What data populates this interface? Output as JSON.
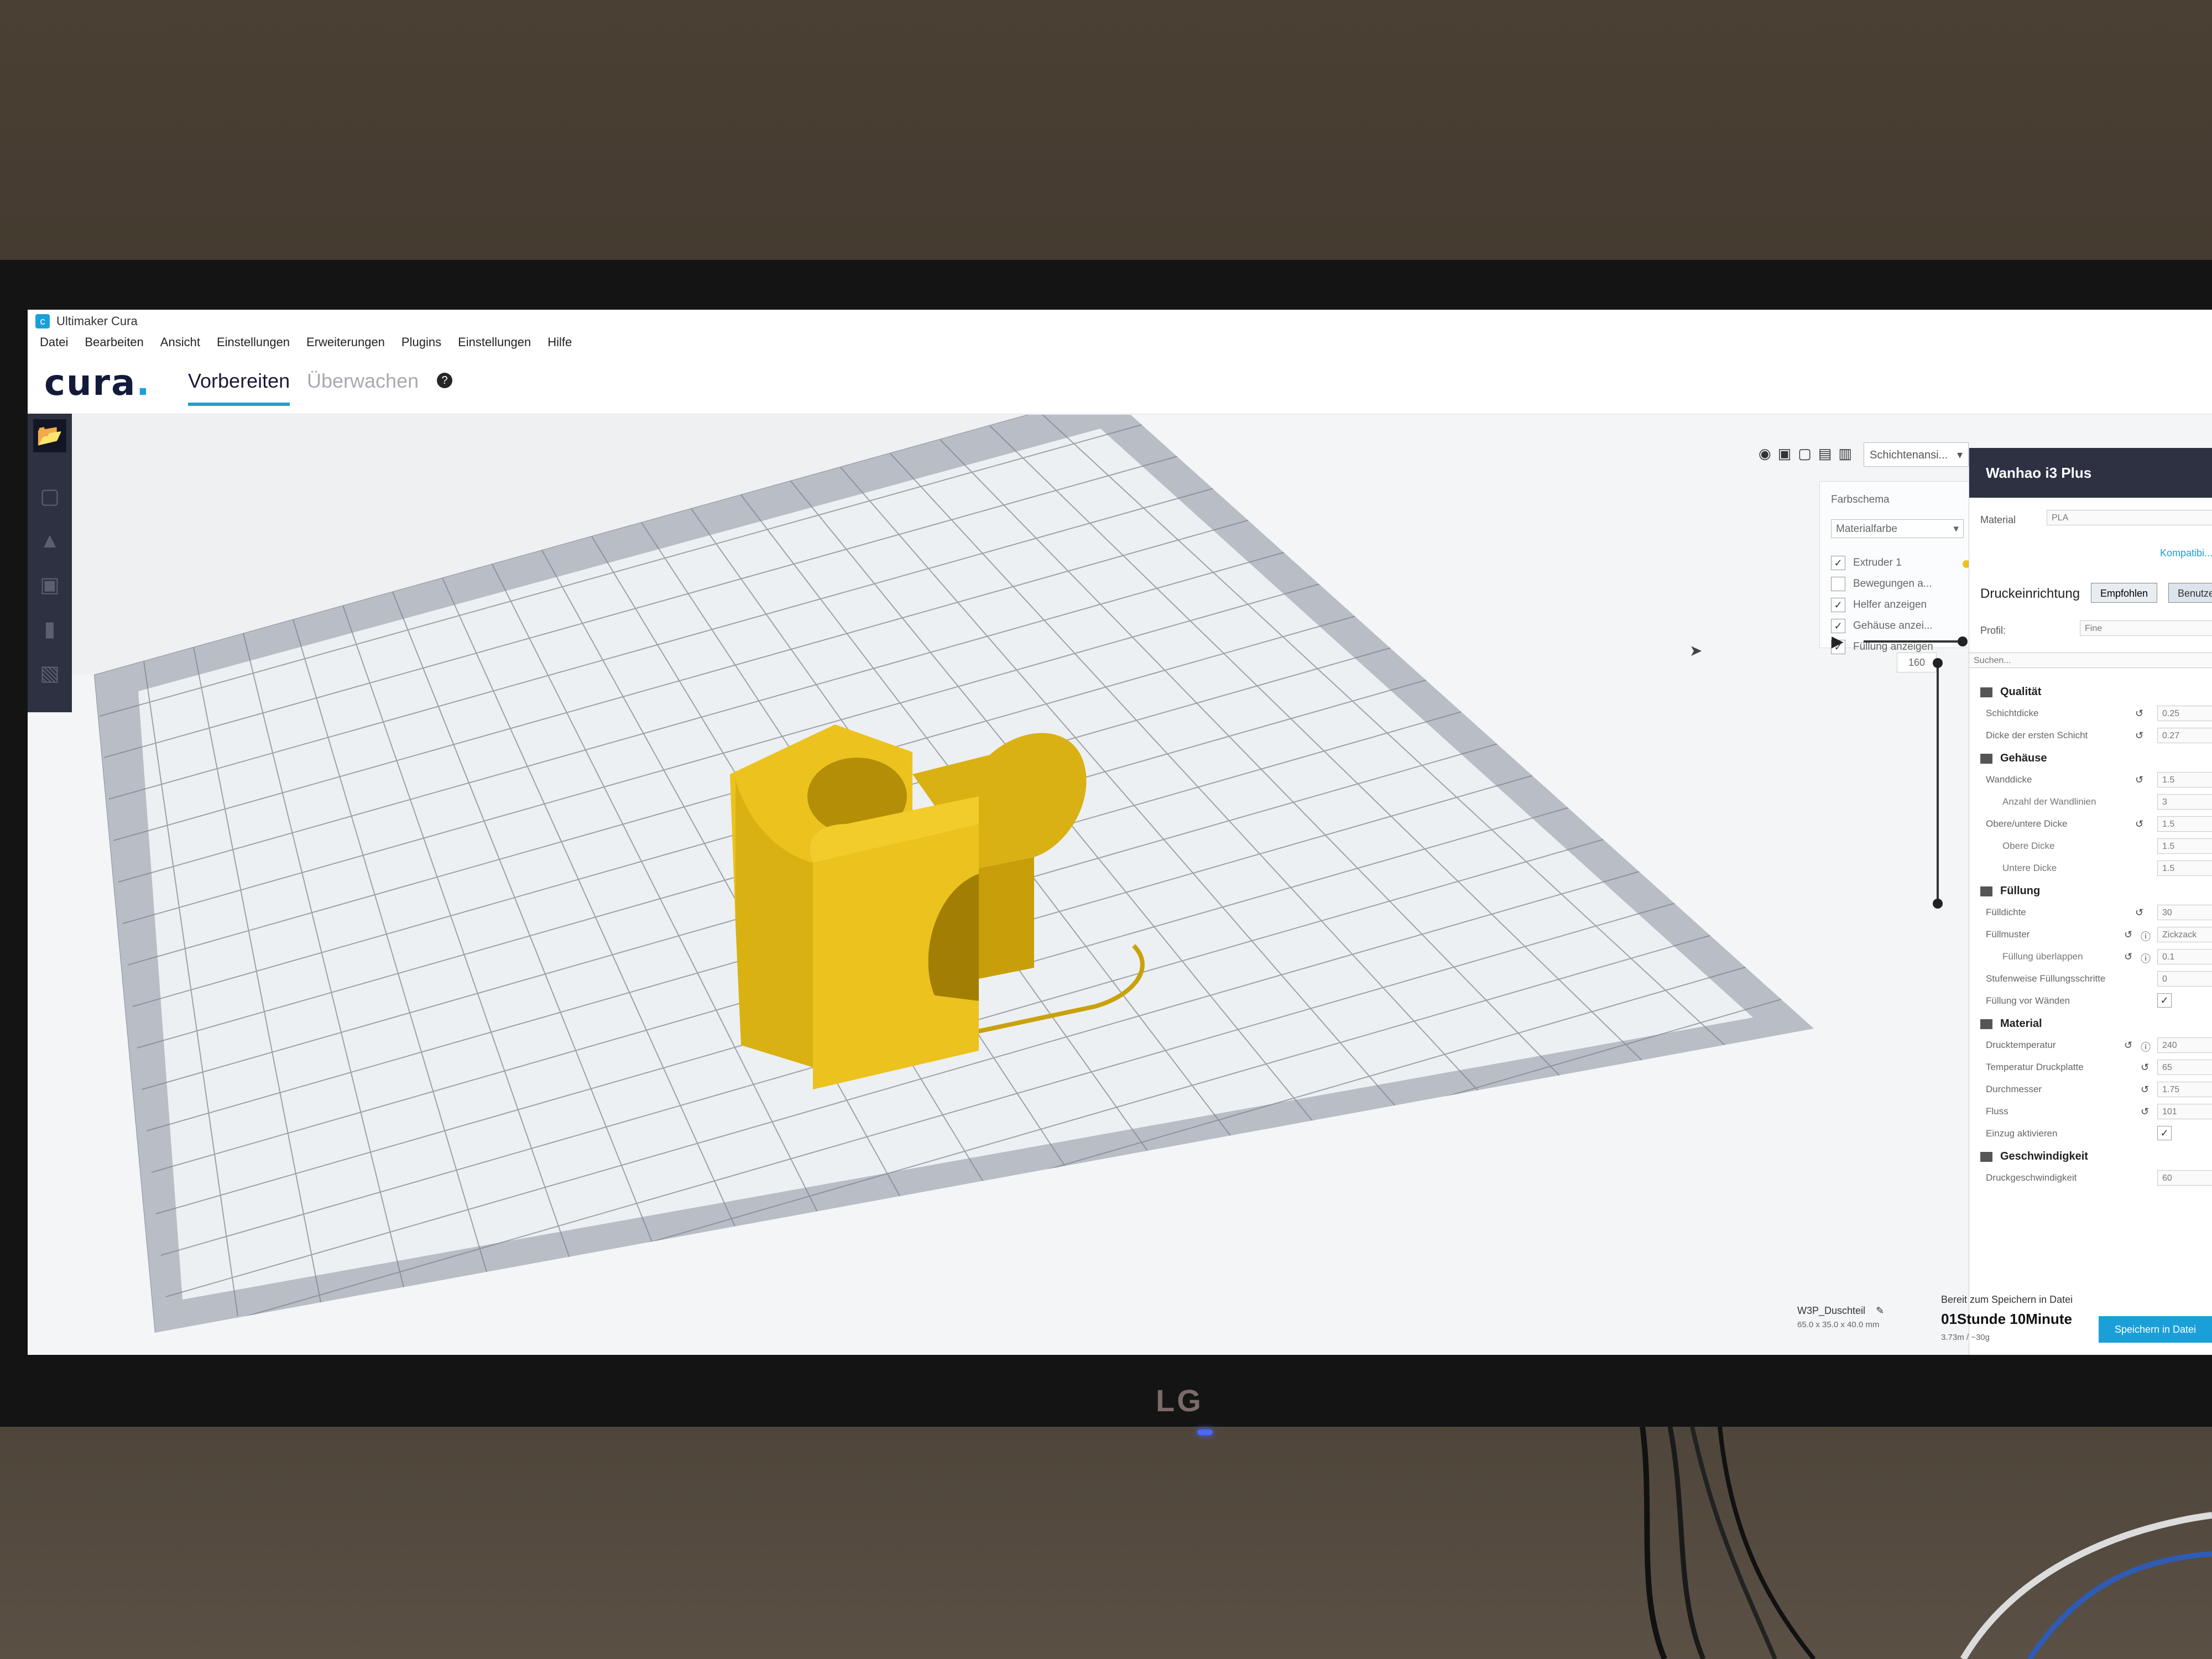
{
  "window": {
    "title": "Ultimaker Cura"
  },
  "menu": [
    "Datei",
    "Bearbeiten",
    "Ansicht",
    "Einstellungen",
    "Erweiterungen",
    "Plugins",
    "Einstellungen",
    "Hilfe"
  ],
  "header": {
    "logo": "cura",
    "tab_prepare": "Vorbereiten",
    "tab_monitor": "Überwachen"
  },
  "view": {
    "mode": "Schichtenansi..."
  },
  "layer_panel": {
    "color_scheme_label": "Farbschema",
    "color_scheme_value": "Materialfarbe",
    "options": [
      {
        "label": "Extruder 1",
        "checked": true
      },
      {
        "label": "Bewegungen a...",
        "checked": false
      },
      {
        "label": "Helfer anzeigen",
        "checked": true
      },
      {
        "label": "Gehäuse anzei...",
        "checked": true
      },
      {
        "label": "Füllung anzeigen",
        "checked": true
      }
    ],
    "layer_value": "160"
  },
  "object": {
    "name": "W3P_Duschteil",
    "dimensions": "65.0 x 35.0 x 40.0 mm"
  },
  "settings": {
    "machine": "Wanhao i3 Plus",
    "material_label": "Material",
    "material_value": "PLA",
    "compat_link": "Kompatibi...",
    "print_setup": "Druckeinrichtung",
    "mode_recommended": "Empfohlen",
    "mode_custom": "Benutzer...",
    "profile_label": "Profil:",
    "profile_value": "Fine",
    "search_placeholder": "Suchen...",
    "sections": {
      "quality": "Qualität",
      "shell": "Gehäuse",
      "infill": "Füllung",
      "material": "Material",
      "speed": "Geschwindigkeit"
    },
    "rows": {
      "layer_height": {
        "label": "Schichtdicke",
        "value": "0.25"
      },
      "initial_layer": {
        "label": "Dicke der ersten Schicht",
        "value": "0.27"
      },
      "wall_thickness": {
        "label": "Wanddicke",
        "value": "1.5"
      },
      "wall_lines": {
        "label": "Anzahl der Wandlinien",
        "value": "3"
      },
      "top_bottom": {
        "label": "Obere/untere Dicke",
        "value": "1.5"
      },
      "top_thickness": {
        "label": "Obere Dicke",
        "value": "1.5"
      },
      "bottom_thickness": {
        "label": "Untere Dicke",
        "value": "1.5"
      },
      "infill_density": {
        "label": "Fülldichte",
        "value": "30"
      },
      "infill_pattern": {
        "label": "Füllmuster",
        "value": "Zickzack"
      },
      "infill_overlap": {
        "label": "Füllung überlappen",
        "value": "0.1"
      },
      "gradual_infill": {
        "label": "Stufenweise Füllungsschritte",
        "value": "0"
      },
      "infill_before_walls": {
        "label": "Füllung vor Wänden"
      },
      "print_temp": {
        "label": "Drucktemperatur",
        "value": "240"
      },
      "bed_temp": {
        "label": "Temperatur Druckplatte",
        "value": "65"
      },
      "diameter": {
        "label": "Durchmesser",
        "value": "1.75"
      },
      "flow": {
        "label": "Fluss",
        "value": "101"
      },
      "retraction": {
        "label": "Einzug aktivieren"
      },
      "print_speed": {
        "label": "Druckgeschwindigkeit",
        "value": "60"
      }
    }
  },
  "footer": {
    "status": "Bereit zum Speichern in Datei",
    "time": "01Stunde 10Minute",
    "material": "3.73m / ~30g",
    "save_button": "Speichern in Datei"
  },
  "monitor_brand": "LG",
  "colors": {
    "accent": "#1a9fd9",
    "model": "#ecc21e",
    "panel_dark": "#2d3142"
  }
}
